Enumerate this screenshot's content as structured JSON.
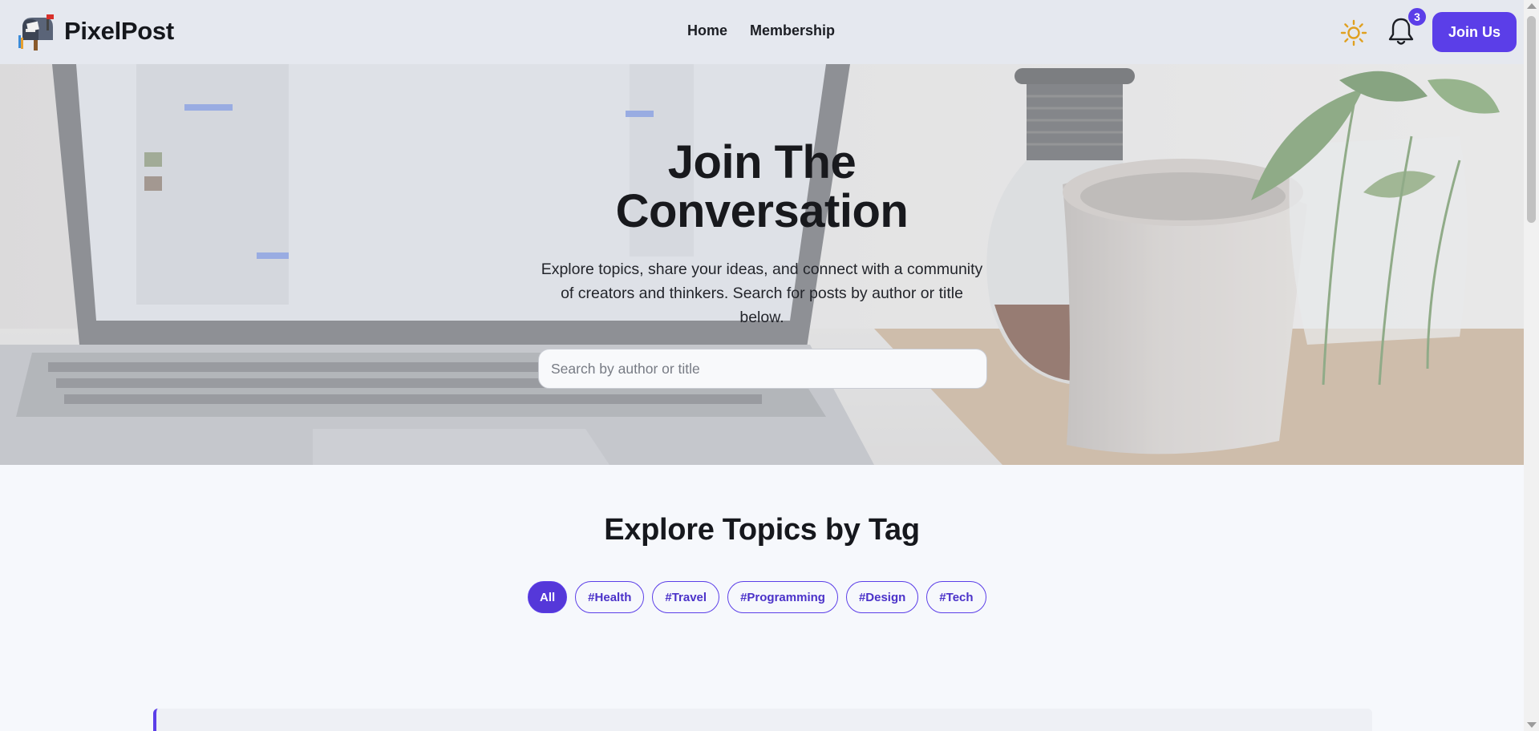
{
  "nav": {
    "brand": "PixelPost",
    "logo_icon": "mailbox-icon",
    "links": [
      "Home",
      "Membership"
    ],
    "theme_icon": "sun-icon",
    "notification_icon": "bell-icon",
    "notification_count": "3",
    "join_label": "Join Us"
  },
  "hero": {
    "title": "Join The Conversation",
    "subtitle": "Explore topics, share your ideas, and connect with a community of creators and thinkers. Search for posts by author or title below.",
    "search_placeholder": "Search by author or title",
    "search_value": ""
  },
  "topics": {
    "title": "Explore Topics by Tag",
    "tags": [
      "All",
      "#Health",
      "#Travel",
      "#Programming",
      "#Design",
      "#Tech"
    ],
    "active_tag": "All"
  },
  "colors": {
    "accent": "#5b3ee8",
    "navbar_bg": "#e5e8ef",
    "page_bg": "#f6f8fc",
    "sun": "#e0a020"
  }
}
